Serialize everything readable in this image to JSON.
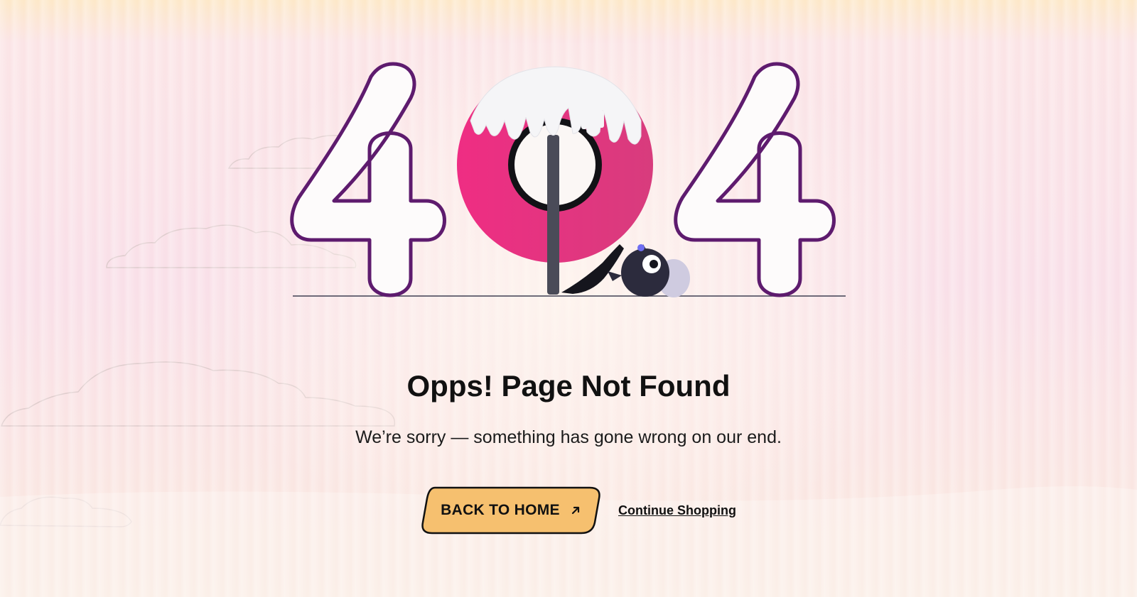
{
  "error": {
    "code_digits": [
      "4",
      "0",
      "4"
    ],
    "title": "Opps! Page Not Found",
    "message": "We’re sorry — something has gone wrong on our end."
  },
  "actions": {
    "home_label": "BACK TO HOME",
    "shop_label": "Continue Shopping"
  },
  "icons": {
    "home_arrow": "arrow-up-right-icon"
  },
  "colors": {
    "accent_pink": "#e8307f",
    "outline_purple": "#5e1b6e",
    "button_fill": "#f6c06f",
    "text_dark": "#111111"
  }
}
